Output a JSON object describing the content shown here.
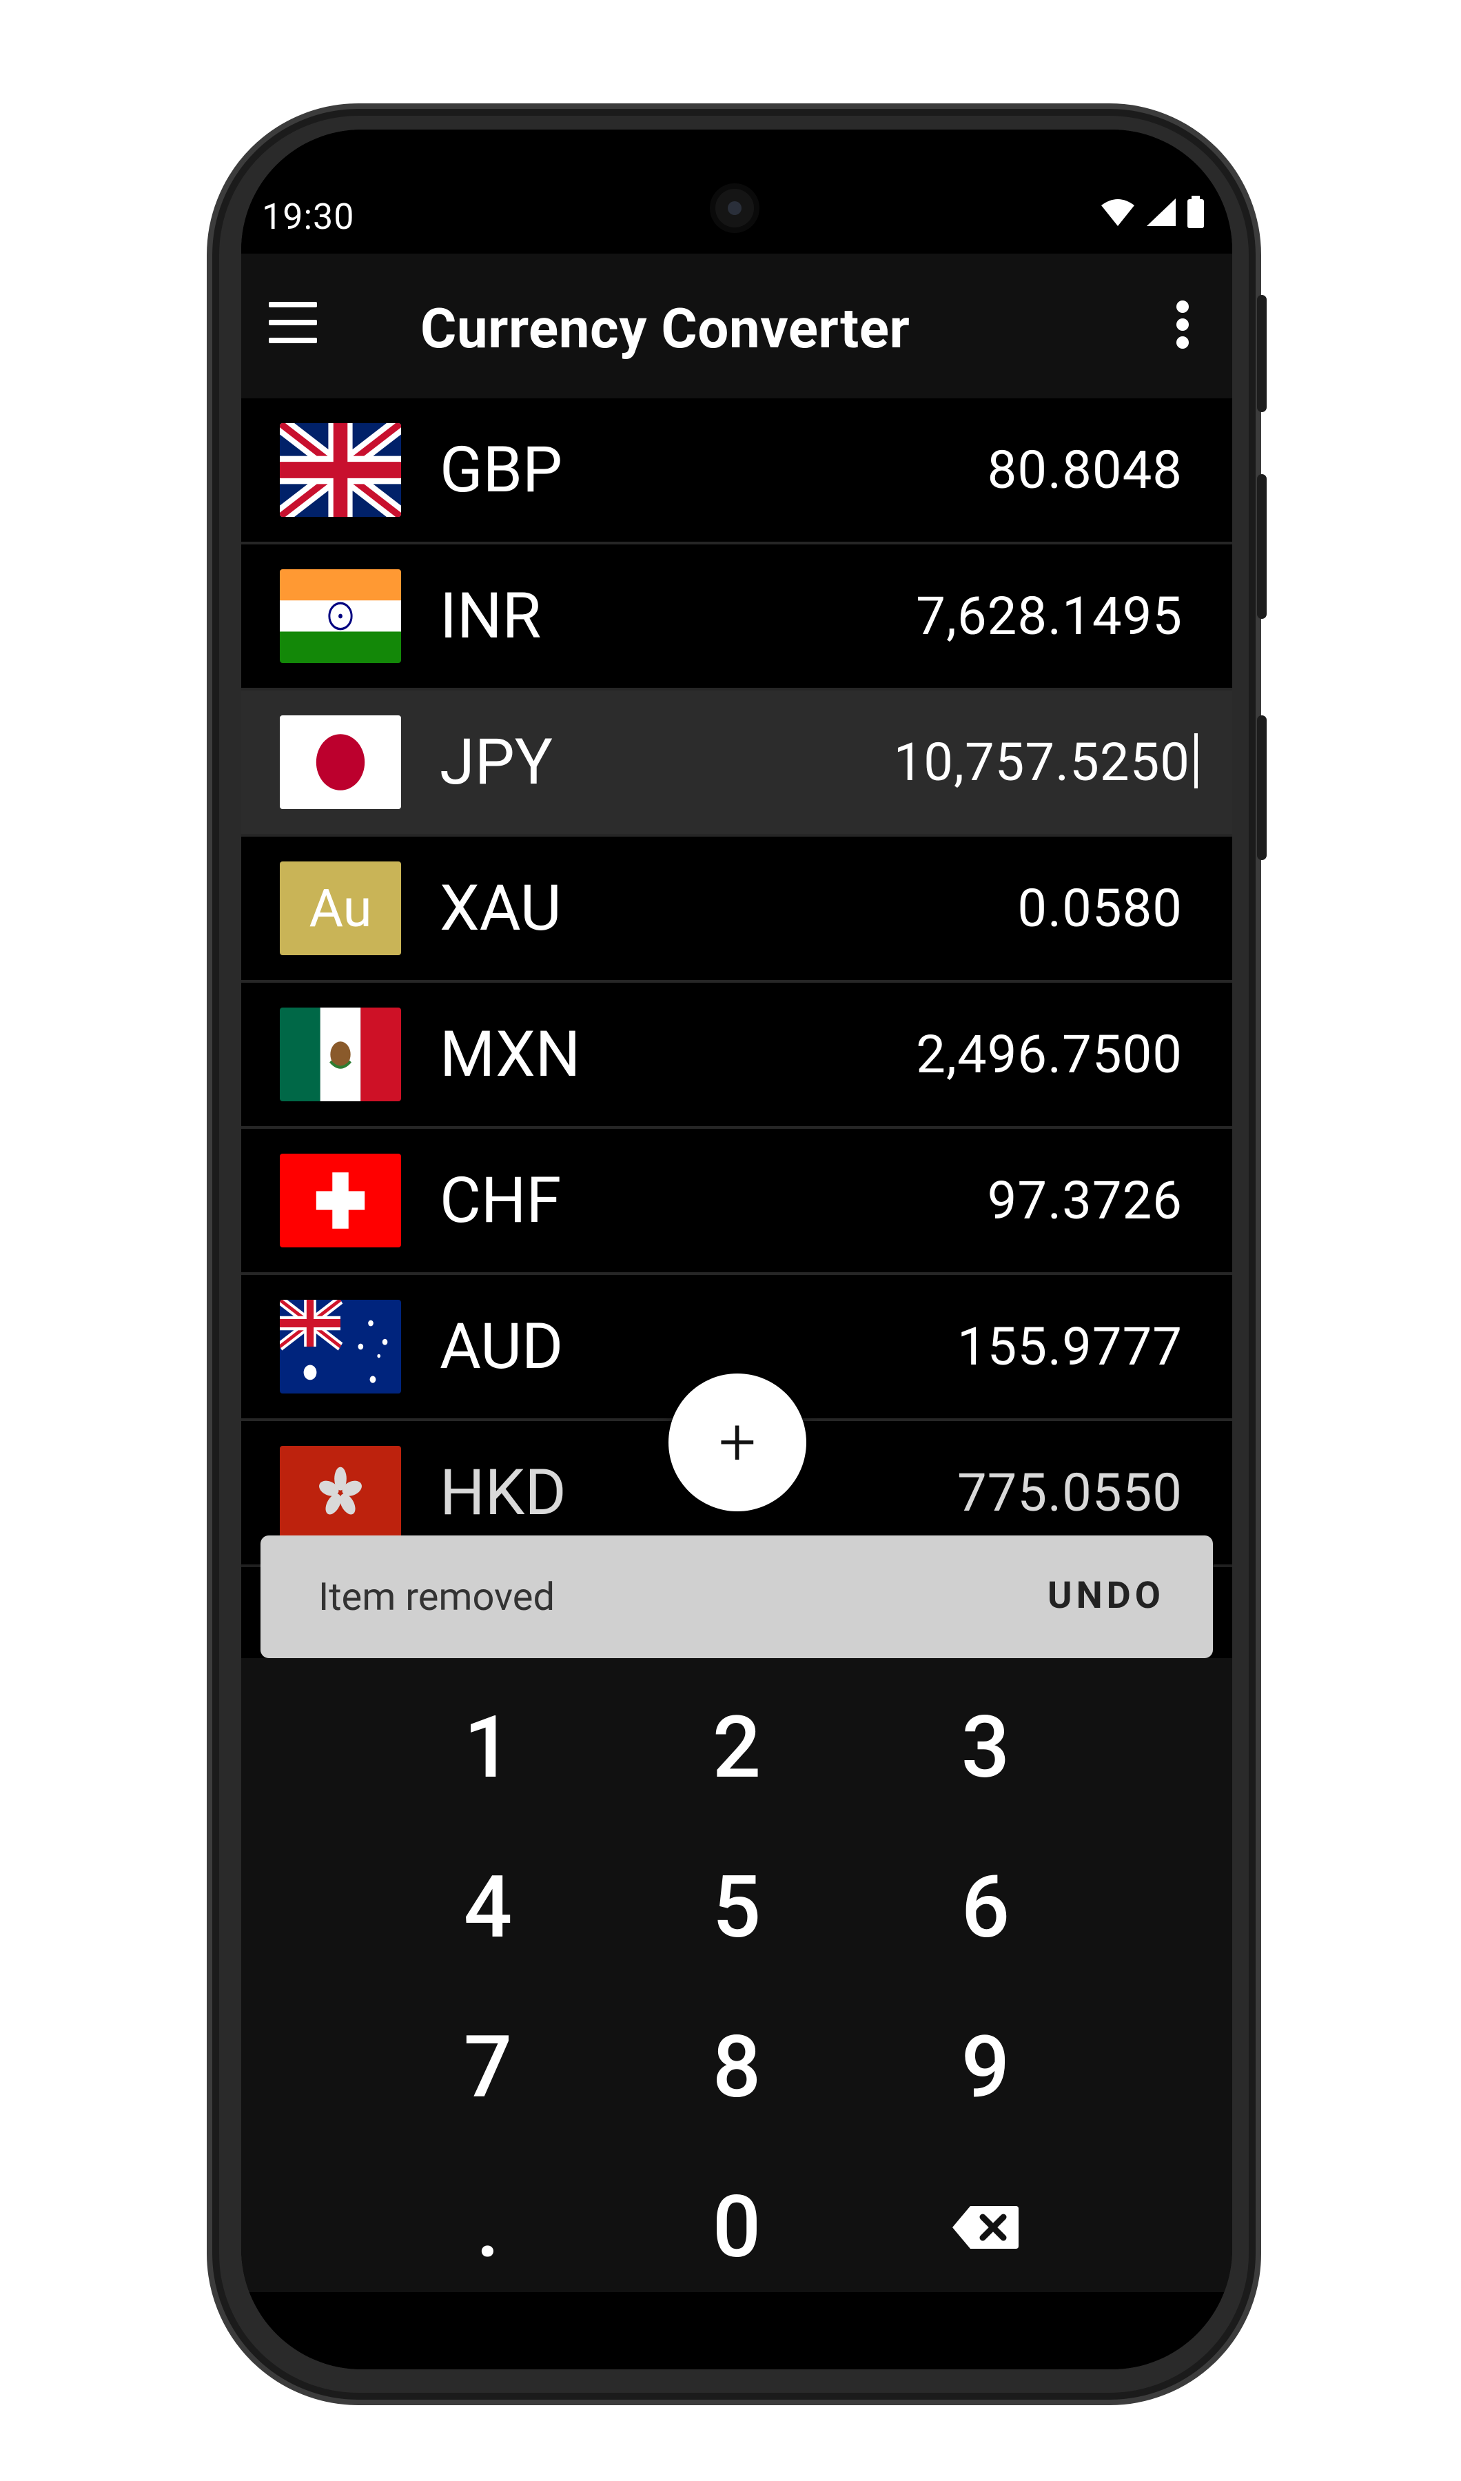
{
  "status_bar": {
    "time": "19:30"
  },
  "app_bar": {
    "title": "Currency Converter",
    "menu_icon": "hamburger-menu-icon",
    "more_icon": "more-vert-icon"
  },
  "currencies": [
    {
      "code": "GBP",
      "value": "80.8048",
      "flag": "uk-flag-icon"
    },
    {
      "code": "INR",
      "value": "7,628.1495",
      "flag": "india-flag-icon"
    },
    {
      "code": "JPY",
      "value": "10,757.5250",
      "flag": "japan-flag-icon",
      "selected": true
    },
    {
      "code": "XAU",
      "value": "0.0580",
      "flag": "gold-icon",
      "flag_text": "Au"
    },
    {
      "code": "MXN",
      "value": "2,496.7500",
      "flag": "mexico-flag-icon"
    },
    {
      "code": "CHF",
      "value": "97.3726",
      "flag": "switzerland-flag-icon"
    },
    {
      "code": "AUD",
      "value": "155.9777",
      "flag": "australia-flag-icon"
    },
    {
      "code": "HKD",
      "value": "775.0550",
      "flag": "hongkong-flag-icon"
    }
  ],
  "fab": {
    "label": "+"
  },
  "snackbar": {
    "message": "Item removed",
    "action": "UNDO"
  },
  "keypad": {
    "keys": [
      "1",
      "2",
      "3",
      "4",
      "5",
      "6",
      "7",
      "8",
      "9",
      ".",
      "0"
    ],
    "backspace_icon": "backspace-icon"
  },
  "colors": {
    "background": "#000000",
    "selected_row": "#2c2c2c",
    "snackbar": "#d0d0d0",
    "gold": "#c9b457"
  }
}
